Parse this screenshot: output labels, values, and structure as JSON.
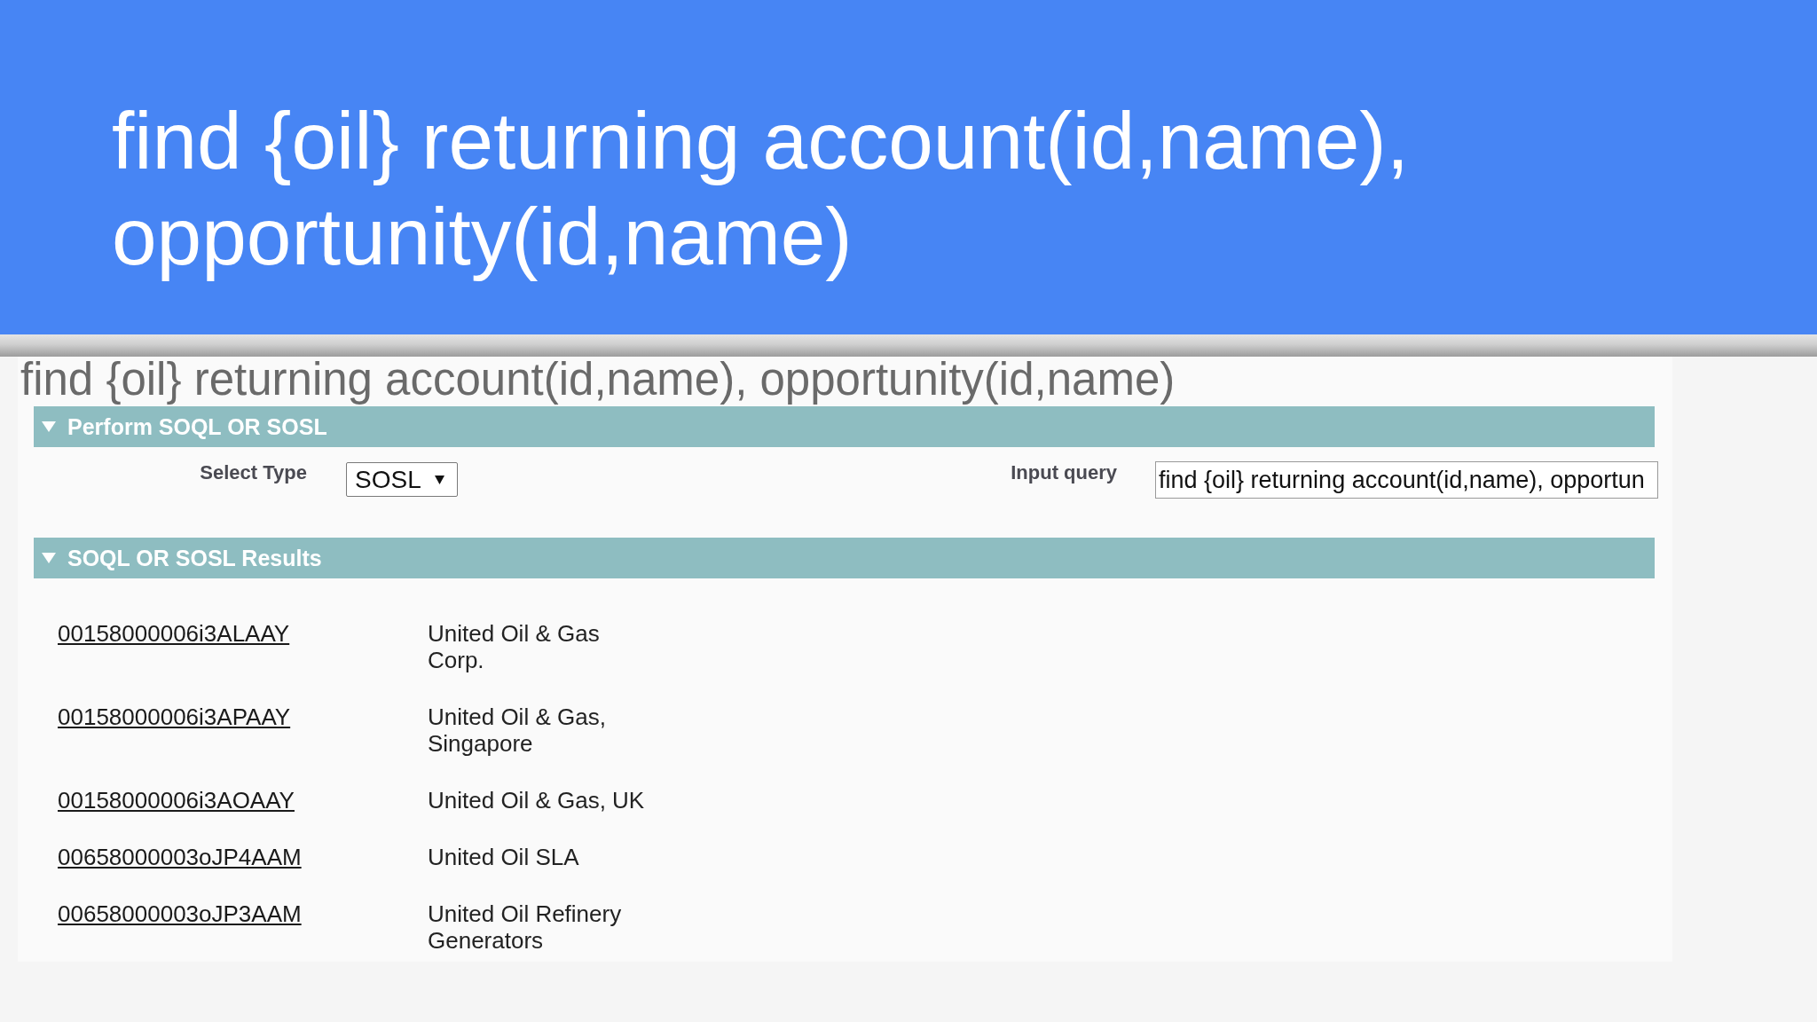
{
  "slide": {
    "title": "find {oil} returning account(id,name), opportunity(id,name)"
  },
  "page": {
    "query_heading": "find {oil} returning account(id,name), opportunity(id,name)",
    "sections": [
      {
        "kind": "form",
        "title": "Perform SOQL OR SOSL",
        "expanded": true,
        "select_type": {
          "label": "Select Type",
          "value": "SOSL"
        },
        "input_query": {
          "label": "Input query",
          "value": "find {oil} returning account(id,name), opportun"
        }
      },
      {
        "kind": "results",
        "title": "SOQL OR SOSL Results",
        "expanded": true,
        "rows": [
          {
            "id": "00158000006i3ALAAY",
            "name": "United Oil & Gas Corp."
          },
          {
            "id": "00158000006i3APAAY",
            "name": "United Oil & Gas, Singapore"
          },
          {
            "id": "00158000006i3AOAAY",
            "name": "United Oil & Gas, UK"
          },
          {
            "id": "00658000003oJP4AAM",
            "name": "United Oil SLA"
          },
          {
            "id": "00658000003oJP3AAM",
            "name": "United Oil Refinery Generators"
          }
        ]
      }
    ]
  }
}
